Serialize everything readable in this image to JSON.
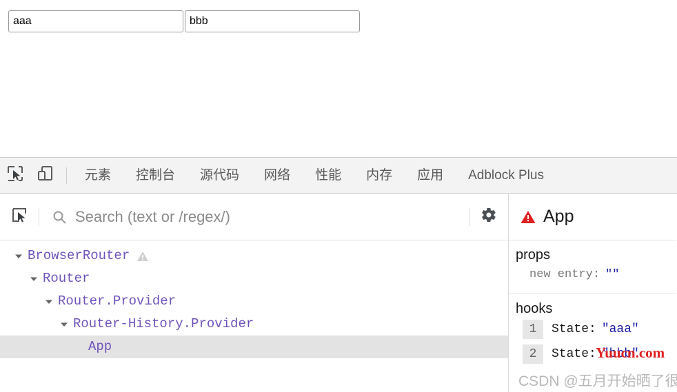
{
  "page": {
    "inputs": [
      {
        "name": "first-input",
        "value": "aaa",
        "placeholder": ""
      },
      {
        "name": "second-input",
        "value": "bbb",
        "placeholder": ""
      }
    ]
  },
  "devtools": {
    "toolbar": {
      "inspect_icon": "inspect-element-icon",
      "device_icon": "device-toolbar-icon",
      "tabs": [
        {
          "label": "元素",
          "active": false
        },
        {
          "label": "控制台",
          "active": false
        },
        {
          "label": "源代码",
          "active": false
        },
        {
          "label": "网络",
          "active": false
        },
        {
          "label": "性能",
          "active": false
        },
        {
          "label": "内存",
          "active": false
        },
        {
          "label": "应用",
          "active": false
        },
        {
          "label": "Adblock Plus",
          "active": false
        }
      ]
    },
    "react_panel": {
      "select_icon": "select-component-icon",
      "search_icon": "search-icon",
      "search": {
        "value": "",
        "placeholder": "Search (text or /regex/)"
      },
      "settings_icon": "gear-icon",
      "tree": [
        {
          "label": "BrowserRouter",
          "depth": 0,
          "expanded": true,
          "warning": true,
          "selected": false
        },
        {
          "label": "Router",
          "depth": 1,
          "expanded": true,
          "warning": false,
          "selected": false
        },
        {
          "label": "Router.Provider",
          "depth": 2,
          "expanded": true,
          "warning": false,
          "selected": false
        },
        {
          "label": "Router-History.Provider",
          "depth": 3,
          "expanded": true,
          "warning": false,
          "selected": false
        },
        {
          "label": "App",
          "depth": 4,
          "expanded": null,
          "warning": false,
          "selected": true
        }
      ],
      "inspector": {
        "warning_icon": "error-triangle-icon",
        "component_name": "App",
        "props": {
          "title": "props",
          "rows": [
            {
              "key": "new entry:",
              "value": "\"\""
            }
          ]
        },
        "hooks": {
          "title": "hooks",
          "rows": [
            {
              "index": "1",
              "name": "State",
              "colon": ":",
              "value": "\"aaa\""
            },
            {
              "index": "2",
              "name": "State",
              "colon": ":",
              "value": "\"bbb\""
            }
          ]
        }
      }
    }
  },
  "watermarks": {
    "red": "Yuucn.com",
    "csdn": "CSDN @五月开始晒了很凉快"
  },
  "colors": {
    "tree_component": "#6f53bb",
    "value_blue": "#1a1aa6",
    "error_red": "#e02020",
    "warning_gray": "#cfcfcf",
    "selected_row": "#e3e3e3",
    "toolbar_bg": "#f3f3f3"
  }
}
